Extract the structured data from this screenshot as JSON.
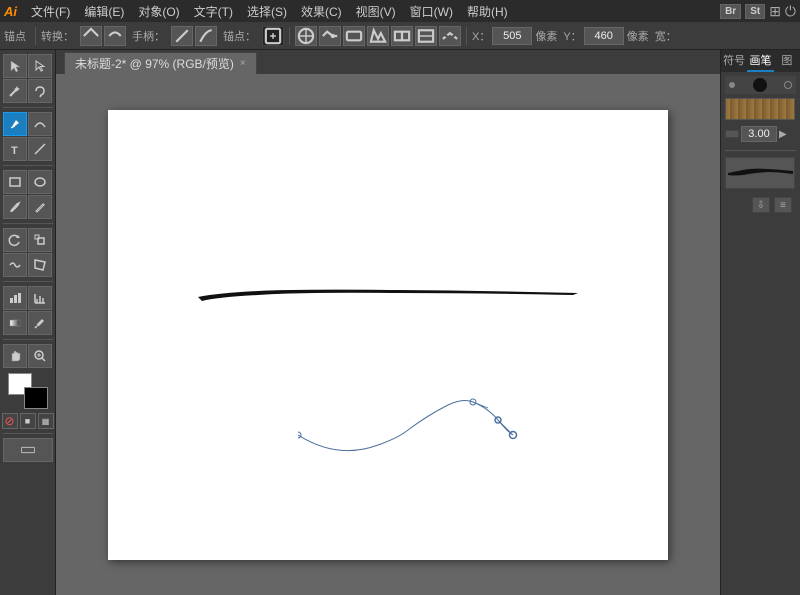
{
  "app": {
    "logo": "Ai",
    "title": "未标题-2* @ 97% (RGB/预览)"
  },
  "menubar": {
    "items": [
      "文件(F)",
      "编辑(E)",
      "对象(O)",
      "文字(T)",
      "选择(S)",
      "效果(C)",
      "视图(V)",
      "窗口(W)",
      "帮助(H)"
    ]
  },
  "toolbar": {
    "label_anchor": "锚点",
    "label_convert": "转换：",
    "label_handle": "手柄：",
    "label_anchor2": "锚点：",
    "label_x": "X：",
    "label_y": "Y：",
    "label_width": "宽：",
    "x_value": "505",
    "y_value": "460",
    "unit": "像素"
  },
  "tabs": [
    {
      "label": "未标题-2* @ 97% (RGB/预览)",
      "active": true
    }
  ],
  "right_panel": {
    "tabs": [
      "符号",
      "画笔",
      "图"
    ],
    "active_tab": "画笔",
    "brush_size": "3.00"
  },
  "colors": {
    "accent_blue": "#1a7fc1",
    "bg_dark": "#2b2b2b",
    "bg_mid": "#3c3c3c",
    "bg_light": "#555555"
  }
}
